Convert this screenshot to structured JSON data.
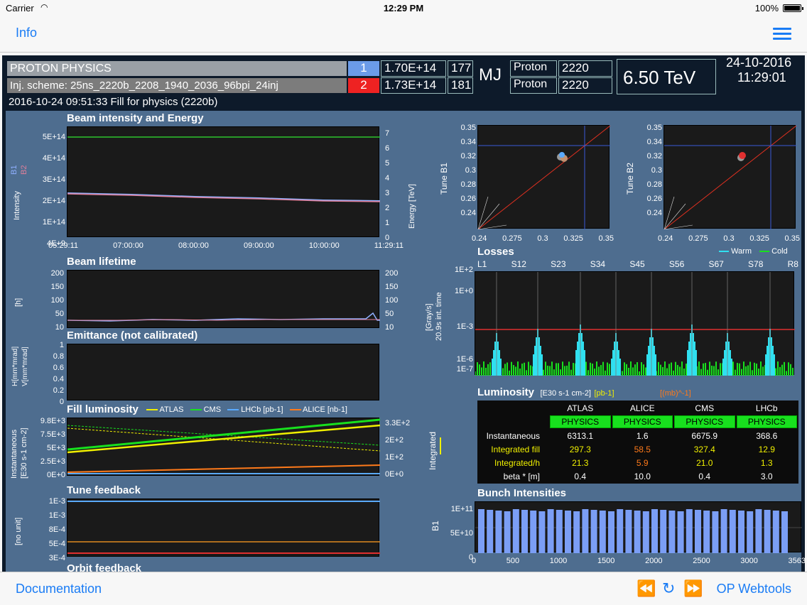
{
  "statusbar": {
    "carrier": "Carrier",
    "time": "12:29 PM",
    "battery": "100%"
  },
  "nav": {
    "info": "Info"
  },
  "toolbar": {
    "documentation": "Documentation",
    "op_webtools": "OP Webtools"
  },
  "header": {
    "mode": "PROTON PHYSICS",
    "injscheme": "Inj. scheme: 25ns_2220b_2208_1940_2036_96bpi_24inj",
    "fillinfo": "2016-10-24  09:51:33  Fill for physics (2220b)",
    "beam1_num": "1",
    "beam2_num": "2",
    "beam1_int": "1.70E+14",
    "beam2_int": "1.73E+14",
    "beam1_mj": "177",
    "beam2_mj": "181",
    "mj": "MJ",
    "beam1_type": "Proton",
    "beam2_type": "Proton",
    "beam1_bunches": "2220",
    "beam2_bunches": "2220",
    "energy": "6.50 TeV",
    "date": "24-10-2016",
    "clock": "11:29:01"
  },
  "intensity": {
    "title": "Beam intensity and Energy",
    "yticks": [
      "5E+14",
      "4E+14",
      "3E+14",
      "2E+14",
      "1E+14",
      "4E+9"
    ],
    "rticks": [
      "7",
      "6",
      "5",
      "4",
      "3",
      "2",
      "1",
      "0"
    ],
    "xticks": [
      "05:29:11",
      "07:00:00",
      "08:00:00",
      "09:00:00",
      "10:00:00",
      "11:29:11"
    ],
    "ylabel": "Intensity",
    "rlabel": "Energy  [TeV]",
    "b1": "B1",
    "b2": "B2"
  },
  "lifetime": {
    "title": "Beam lifetime",
    "yticks": [
      "200",
      "150",
      "100",
      "50",
      "10"
    ],
    "rticks": [
      "200",
      "150",
      "100",
      "50",
      "10"
    ],
    "ylabel": "[h]"
  },
  "emittance": {
    "title": "Emittance (not calibrated)",
    "yticks": [
      "1",
      "0.8",
      "0.6",
      "0.4",
      "0.2",
      "0"
    ],
    "ylabel1": "H[mm*mrad]",
    "ylabel2": "V[mm*mrad]"
  },
  "lumifill": {
    "title": "Fill luminosity",
    "legend": [
      "ATLAS",
      "CMS",
      "LHCb  [pb-1]",
      "ALICE  [nb-1]"
    ],
    "legend_colors": [
      "#f0f000",
      "#18e01e",
      "#5aaaff",
      "#ff7a1a"
    ],
    "yticks": [
      "9.8E+3",
      "7.5E+3",
      "5E+3",
      "2.5E+3",
      "0E+0"
    ],
    "rticks": [
      "3.3E+2",
      "2E+2",
      "1E+2",
      "0E+0"
    ],
    "ylabel": "Instantaneous",
    "ylabel2": "[E30 s-1 cm-2]",
    "rlabel": "Integrated"
  },
  "tunefb": {
    "title": "Tune feedback",
    "yticks": [
      "1E-3",
      "1E-3",
      "8E-4",
      "5E-4",
      "3E-4"
    ],
    "ylabel": "[no unit]"
  },
  "orbitfb": {
    "title": "Orbit feedback"
  },
  "tuneb1": {
    "ylabel": "Tune B1",
    "yticks": [
      "0.35",
      "0.34",
      "0.32",
      "0.3",
      "0.28",
      "0.26",
      "0.24"
    ],
    "xticks": [
      "0.24",
      "0.275",
      "0.3",
      "0.325",
      "0.35"
    ]
  },
  "tuneb2": {
    "ylabel": "Tune B2",
    "yticks": [
      "0.35",
      "0.34",
      "0.32",
      "0.3",
      "0.28",
      "0.26",
      "0.24"
    ],
    "xticks": [
      "0.24",
      "0.275",
      "0.3",
      "0.325",
      "0.35"
    ]
  },
  "losses": {
    "title": "Losses",
    "legend_warm": "Warm",
    "legend_cold": "Cold",
    "sectors": [
      "L1",
      "S12",
      "S23",
      "S34",
      "S45",
      "S56",
      "S67",
      "S78",
      "R8"
    ],
    "yticks": [
      "1E+2",
      "1E+0",
      "1E-3",
      "1E-6",
      "1E-7"
    ],
    "ylabel1": "[Gray/s]",
    "ylabel2": "20.9s int. time"
  },
  "luminosity": {
    "title": "Luminosity",
    "unit1": "[E30 s-1 cm-2]",
    "unit2": "[pb-1]",
    "unit3": "[(mb)^-1]",
    "experiments": [
      "ATLAS",
      "ALICE",
      "CMS",
      "LHCb"
    ],
    "status": [
      "PHYSICS",
      "PHYSICS",
      "PHYSICS",
      "PHYSICS"
    ],
    "rows": [
      {
        "label": "Instantaneous",
        "values": [
          "6313.1",
          "1.6",
          "6675.9",
          "368.6"
        ]
      },
      {
        "label": "Integrated fill",
        "values": [
          "297.3",
          "58.5",
          "327.4",
          "12.9"
        ]
      },
      {
        "label": "Integrated/h",
        "values": [
          "21.3",
          "5.9",
          "21.0",
          "1.3"
        ]
      },
      {
        "label": "beta * [m]",
        "values": [
          "0.4",
          "10.0",
          "0.4",
          "3.0"
        ]
      }
    ]
  },
  "bunch": {
    "title": "Bunch Intensities",
    "yticks": [
      "1E+11",
      "5E+10",
      "0"
    ],
    "xticks": [
      "0",
      "500",
      "1000",
      "1500",
      "2000",
      "2500",
      "3000",
      "3563"
    ],
    "ylabel": "B1"
  }
}
